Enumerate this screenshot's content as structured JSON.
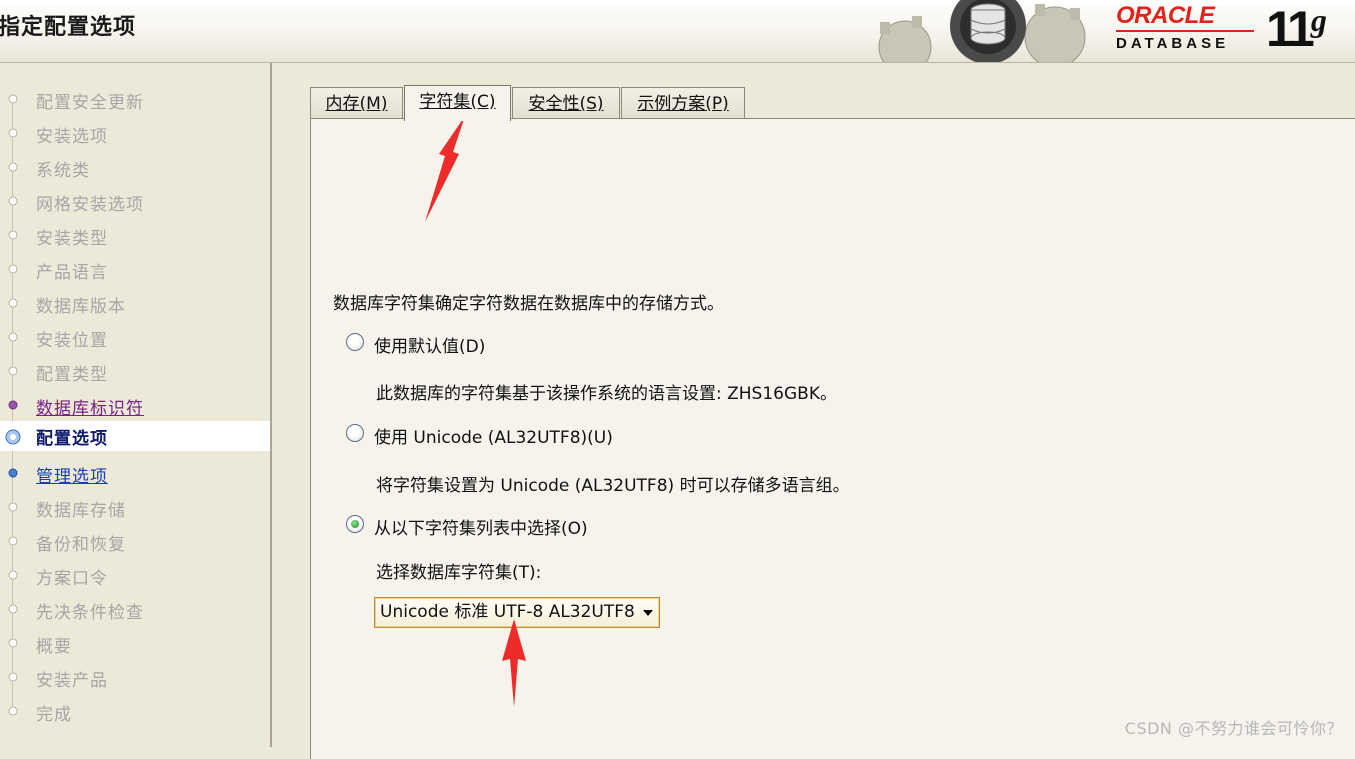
{
  "header": {
    "page_title": "指定配置选项",
    "logo_oracle": "ORACLE",
    "logo_database": "DATABASE",
    "logo_version": "11",
    "logo_version_suffix": "g"
  },
  "sidebar": {
    "steps": [
      {
        "label": "配置安全更新",
        "state": "disabled"
      },
      {
        "label": "安装选项",
        "state": "disabled"
      },
      {
        "label": "系统类",
        "state": "disabled"
      },
      {
        "label": "网格安装选项",
        "state": "disabled"
      },
      {
        "label": "安装类型",
        "state": "disabled"
      },
      {
        "label": "产品语言",
        "state": "disabled"
      },
      {
        "label": "数据库版本",
        "state": "disabled"
      },
      {
        "label": "安装位置",
        "state": "disabled"
      },
      {
        "label": "配置类型",
        "state": "disabled"
      },
      {
        "label": "数据库标识符",
        "state": "done"
      },
      {
        "label": "配置选项",
        "state": "current"
      },
      {
        "label": "管理选项",
        "state": "link"
      },
      {
        "label": "数据库存储",
        "state": "disabled"
      },
      {
        "label": "备份和恢复",
        "state": "disabled"
      },
      {
        "label": "方案口令",
        "state": "disabled"
      },
      {
        "label": "先决条件检查",
        "state": "disabled"
      },
      {
        "label": "概要",
        "state": "disabled"
      },
      {
        "label": "安装产品",
        "state": "disabled"
      },
      {
        "label": "完成",
        "state": "disabled"
      }
    ]
  },
  "tabs": [
    {
      "label": "内存",
      "mnemonic": "(M)",
      "active": false
    },
    {
      "label": "字符集",
      "mnemonic": "(C)",
      "active": true
    },
    {
      "label": "安全性",
      "mnemonic": "(S)",
      "active": false
    },
    {
      "label": "示例方案",
      "mnemonic": "(P)",
      "active": false
    }
  ],
  "charset": {
    "description": "数据库字符集确定字符数据在数据库中的存储方式。",
    "option_default": "使用默认值(D)",
    "option_default_note": "此数据库的字符集基于该操作系统的语言设置: ZHS16GBK。",
    "option_unicode": "使用 Unicode (AL32UTF8)(U)",
    "option_unicode_note": "将字符集设置为 Unicode (AL32UTF8) 时可以存储多语言组。",
    "option_list": "从以下字符集列表中选择(O)",
    "selected_option": "option_list",
    "select_label": "选择数据库字符集(T):",
    "select_value": "Unicode 标准 UTF-8 AL32UTF8"
  },
  "watermark": "CSDN @不努力谁会可怜你？",
  "colors": {
    "background": "#ece9d8",
    "panel": "#f5f3ec",
    "annotation_arrow": "#ee2b2b",
    "oracle_red": "#e2231a"
  }
}
